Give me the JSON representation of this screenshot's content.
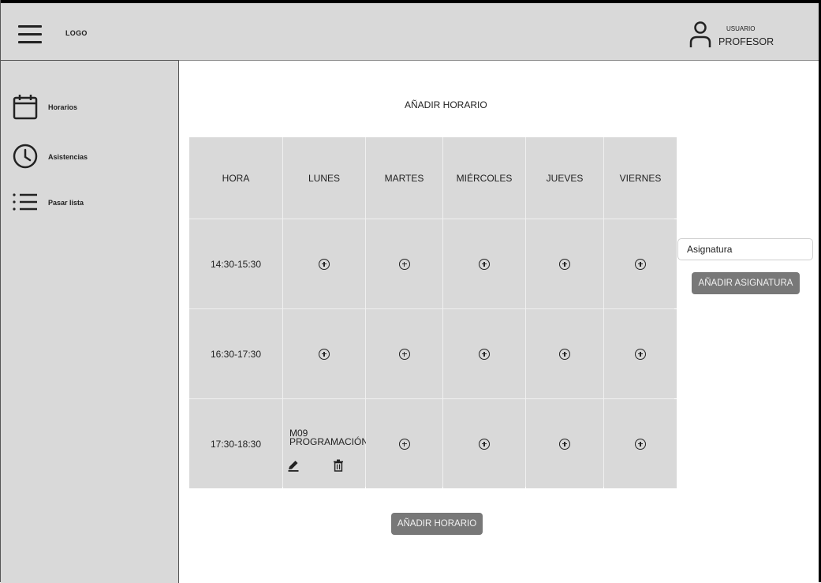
{
  "header": {
    "logo": "LOGO",
    "user_role_small": "USUARIO",
    "user_role": "PROFESOR"
  },
  "sidebar": {
    "items": [
      {
        "label": "Horarios",
        "icon": "calendar-icon"
      },
      {
        "label": "Asistencias",
        "icon": "clock-icon"
      },
      {
        "label": "Pasar lista",
        "icon": "list-icon"
      }
    ]
  },
  "main": {
    "title": "AÑADIR HORARIO",
    "table": {
      "headers": [
        "HORA",
        "LUNES",
        "MARTES",
        "MIÉRCOLES",
        "JUEVES",
        "VIERNES"
      ],
      "rows": [
        {
          "time": "14:30-15:30"
        },
        {
          "time": "16:30-17:30"
        },
        {
          "time": "17:30-18:30",
          "monday_course": "M09\nPROGRAMACIÓN"
        }
      ]
    },
    "add_schedule_button": "AÑADIR HORARIO"
  },
  "side_form": {
    "subject_placeholder": "Asignatura",
    "add_subject_button": "AÑADIR ASIGNATURA"
  },
  "colors": {
    "panel_bg": "#d9d9d9",
    "button_bg": "#787878"
  }
}
